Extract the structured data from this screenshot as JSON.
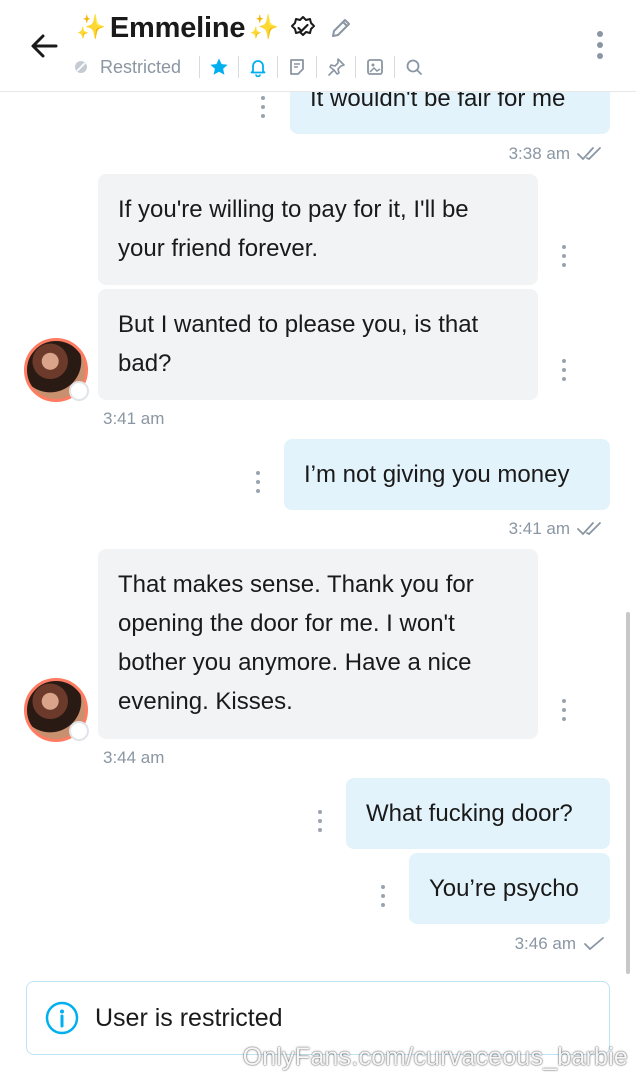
{
  "header": {
    "title": "Emmeline",
    "sparkle_left": "✨",
    "sparkle_right": "✨",
    "status_label": "Restricted",
    "accent_color": "#00aff0"
  },
  "messages": [
    {
      "id": "m0",
      "direction": "out",
      "text": "It wouldn't be fair for me"
    },
    {
      "id": "m0t",
      "time": "3:38 am",
      "receipt": "read"
    },
    {
      "id": "m1",
      "direction": "in",
      "text": "If you're willing to pay for it, I'll be your friend forever."
    },
    {
      "id": "m2",
      "direction": "in",
      "text": "But I wanted to please you, is that bad?"
    },
    {
      "id": "m2t",
      "time": "3:41 am"
    },
    {
      "id": "m3",
      "direction": "out",
      "text": "I’m not giving you money"
    },
    {
      "id": "m3t",
      "time": "3:41 am",
      "receipt": "read"
    },
    {
      "id": "m4",
      "direction": "in",
      "text": "That makes sense. Thank you for opening the door for me. I won't bother you anymore. Have a nice evening. Kisses."
    },
    {
      "id": "m4t",
      "time": "3:44 am"
    },
    {
      "id": "m5",
      "direction": "out",
      "text": "What fucking door?"
    },
    {
      "id": "m6",
      "direction": "out",
      "text": "You’re psycho"
    },
    {
      "id": "m6t",
      "time": "3:46 am",
      "receipt": "sent"
    }
  ],
  "banner": {
    "text": "User is restricted",
    "icon": "info-icon"
  },
  "watermark": "OnlyFans.com/curvaceous_barbie"
}
